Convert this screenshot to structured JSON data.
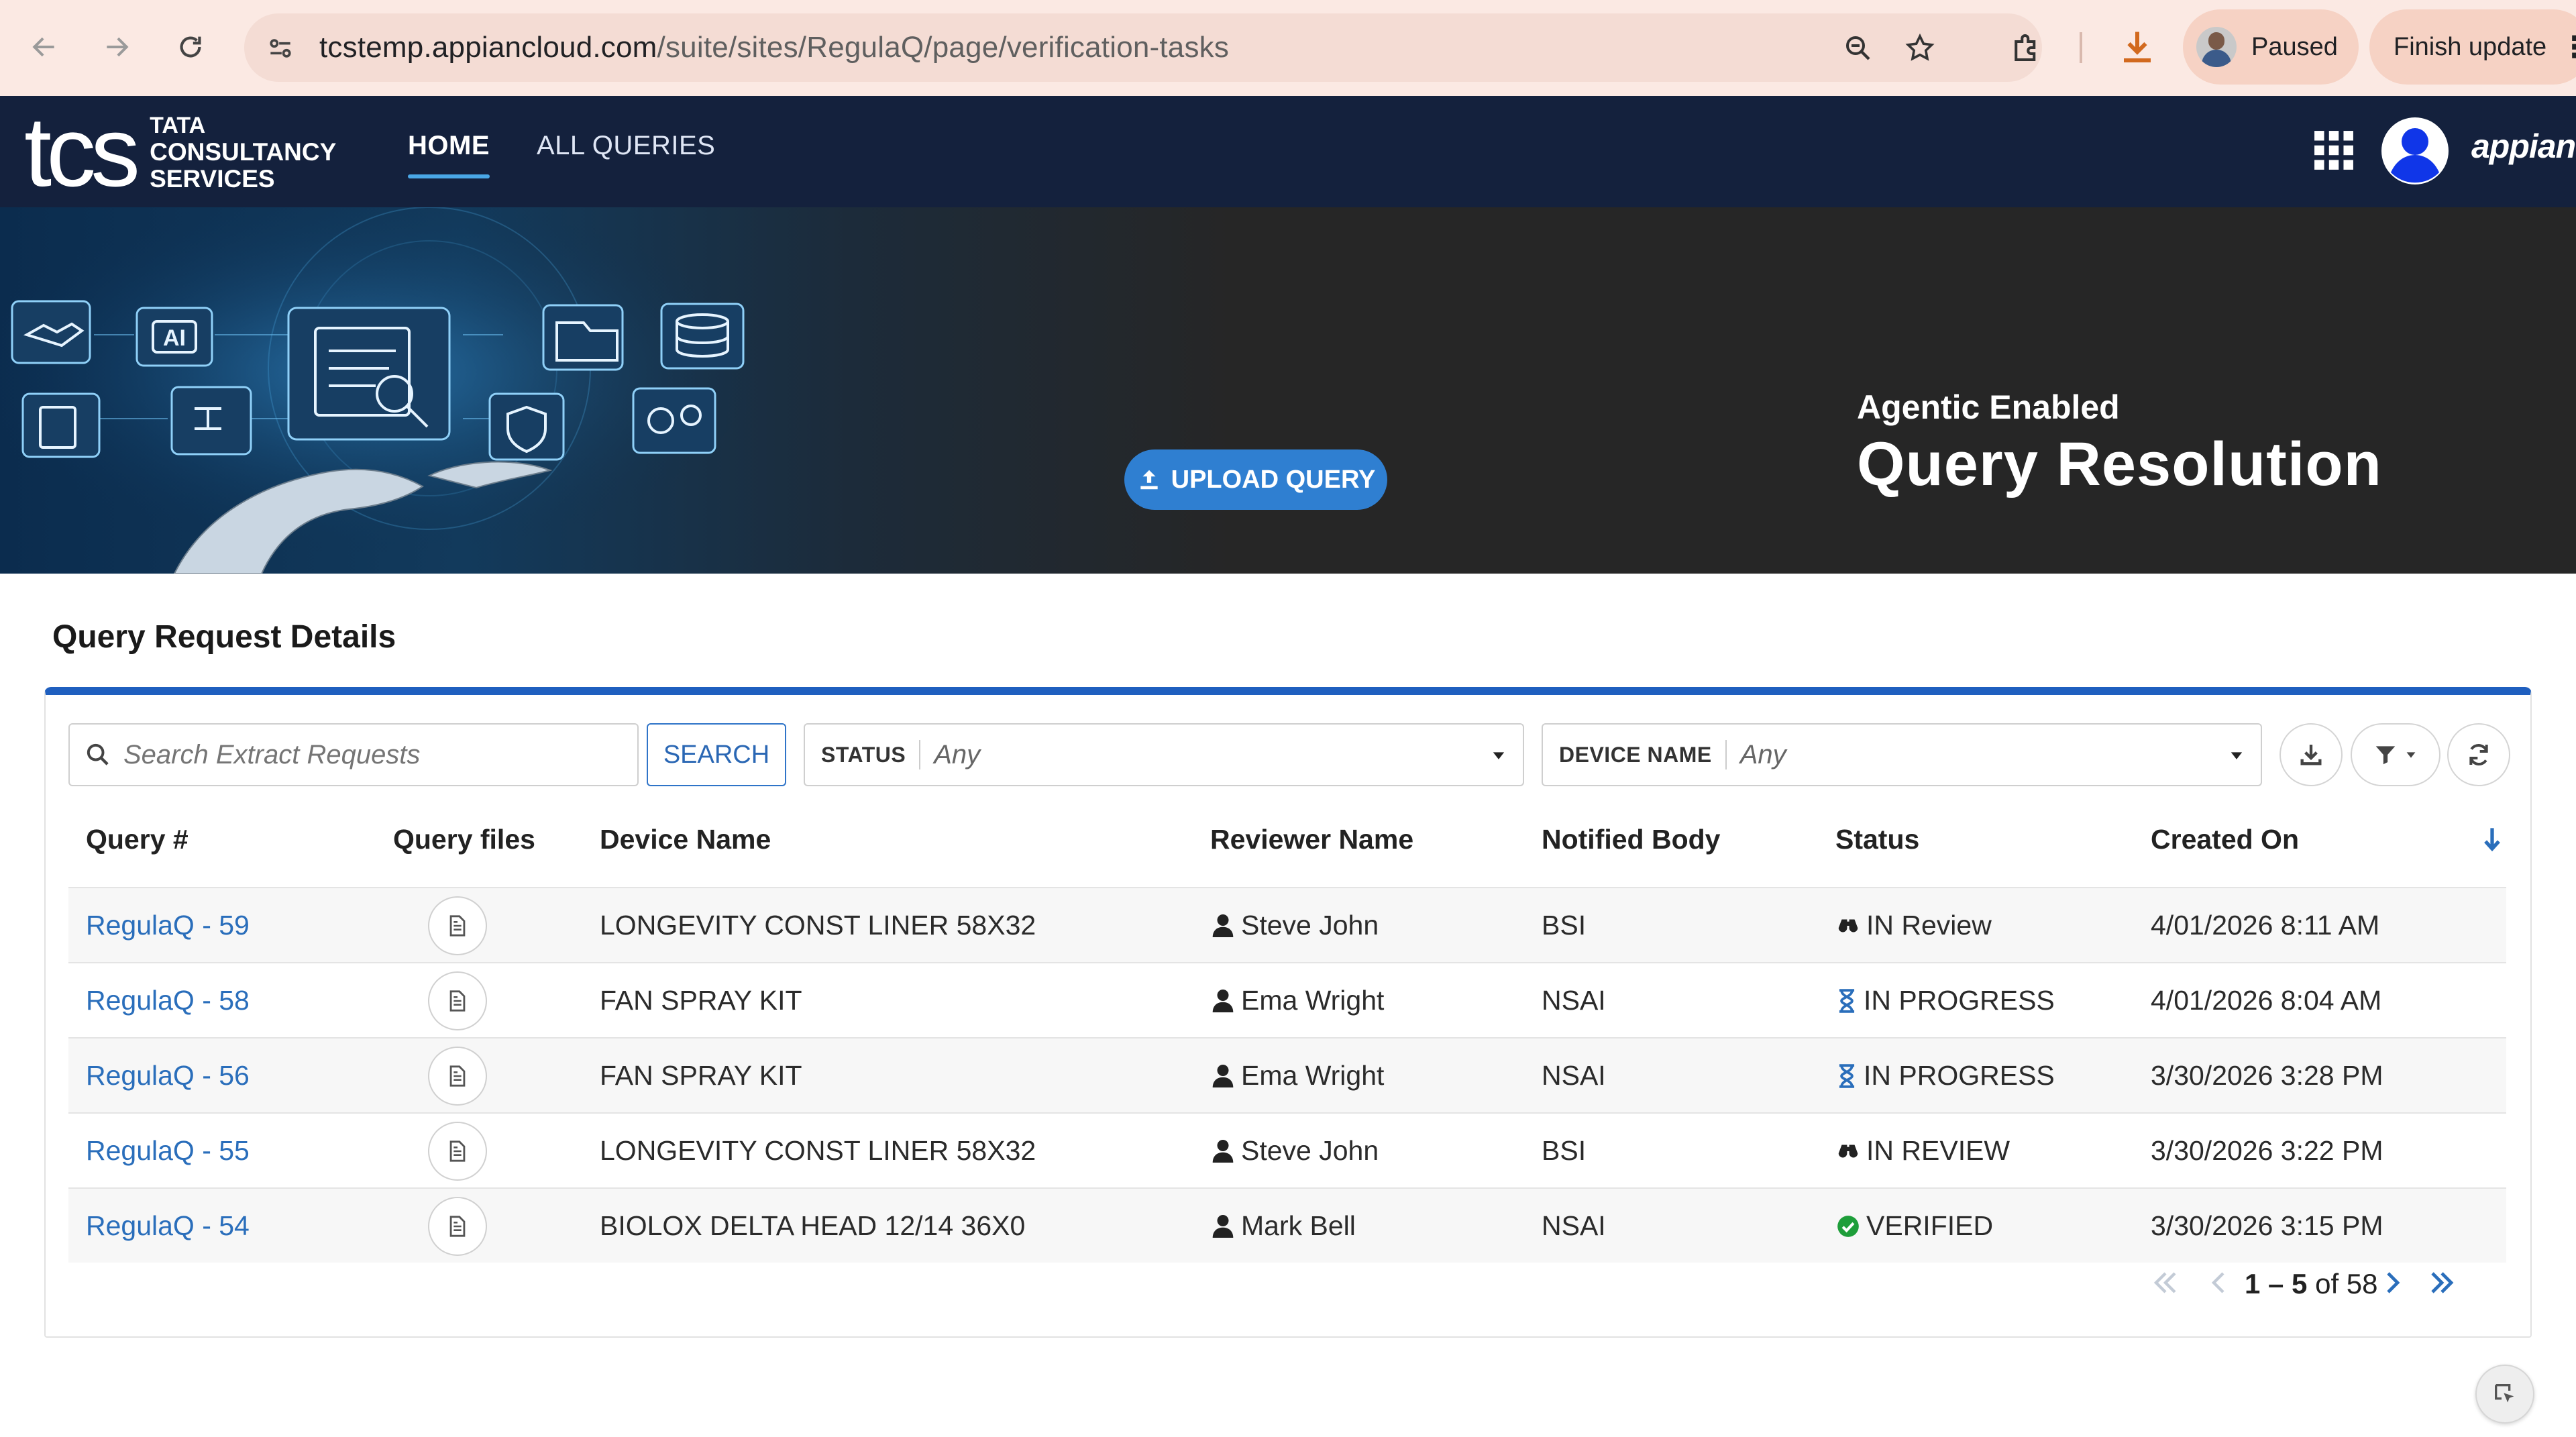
{
  "browser": {
    "url_host": "tcstemp.appiancloud.com",
    "url_path": "/suite/sites/RegulaQ/page/verification-tasks",
    "profile_status": "Paused",
    "update_label": "Finish update"
  },
  "header": {
    "logo_mark": "tcs",
    "logo_line1": "TATA",
    "logo_line2": "CONSULTANCY",
    "logo_line3": "SERVICES",
    "tabs": [
      {
        "label": "HOME",
        "active": true
      },
      {
        "label": "ALL QUERIES",
        "active": false
      }
    ],
    "brand": "appian"
  },
  "banner": {
    "upload_label": "UPLOAD QUERY",
    "subtitle": "Agentic Enabled",
    "title": "Query Resolution",
    "art_ai_label": "AI"
  },
  "main": {
    "section_title": "Query Request Details",
    "search": {
      "placeholder": "Search Extract Requests",
      "button_label": "SEARCH"
    },
    "filters": [
      {
        "label": "STATUS",
        "value": "Any"
      },
      {
        "label": "DEVICE NAME",
        "value": "Any"
      }
    ],
    "columns": [
      "Query #",
      "Query files",
      "Device Name",
      "Reviewer Name",
      "Notified Body",
      "Status",
      "Created On"
    ],
    "rows": [
      {
        "query": "RegulaQ - 59",
        "device": "LONGEVITY CONST LINER 58X32",
        "reviewer": "Steve John",
        "body": "BSI",
        "status": "IN Review",
        "status_icon": "binoculars-icon",
        "created": "4/01/2026 8:11 AM"
      },
      {
        "query": "RegulaQ - 58",
        "device": "FAN SPRAY KIT",
        "reviewer": "Ema Wright",
        "body": "NSAI",
        "status": "IN PROGRESS",
        "status_icon": "hourglass-icon",
        "created": "4/01/2026 8:04 AM"
      },
      {
        "query": "RegulaQ - 56",
        "device": "FAN SPRAY KIT",
        "reviewer": "Ema Wright",
        "body": "NSAI",
        "status": "IN PROGRESS",
        "status_icon": "hourglass-icon",
        "created": "3/30/2026 3:28 PM"
      },
      {
        "query": "RegulaQ - 55",
        "device": "LONGEVITY CONST LINER 58X32",
        "reviewer": "Steve John",
        "body": "BSI",
        "status": "IN REVIEW",
        "status_icon": "binoculars-icon",
        "created": "3/30/2026 3:22 PM"
      },
      {
        "query": "RegulaQ - 54",
        "device": "BIOLOX DELTA HEAD 12/14 36X0",
        "reviewer": "Mark Bell",
        "body": "NSAI",
        "status": "VERIFIED",
        "status_icon": "check-circle-icon",
        "created": "3/30/2026 3:15 PM"
      }
    ],
    "pager": {
      "range": "1 – 5",
      "of_label": "of 58"
    }
  },
  "colors": {
    "header_bg": "#14213d",
    "accent_blue": "#1f5fbf",
    "link": "#2a6ebb",
    "upload_btn": "#2f7fd1",
    "verified_green": "#1e9e3a"
  }
}
